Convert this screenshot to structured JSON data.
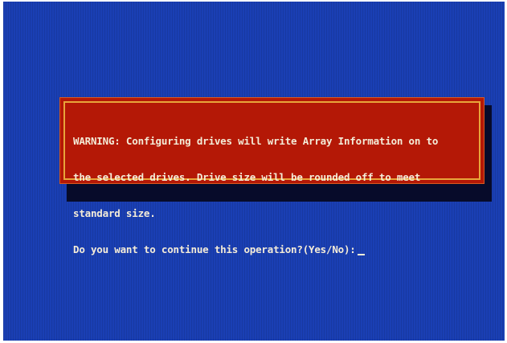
{
  "dialog": {
    "lines": [
      "WARNING: Configuring drives will write Array Information on to",
      "the selected drives. Drive size will be rounded off to meet",
      "standard size.",
      "Do you want to continue this operation?(Yes/No):"
    ]
  },
  "colors": {
    "screen_background": "#1a3fb4",
    "dialog_background": "#b41806",
    "dialog_border": "#e8a53a",
    "text": "#f4ecd8"
  }
}
